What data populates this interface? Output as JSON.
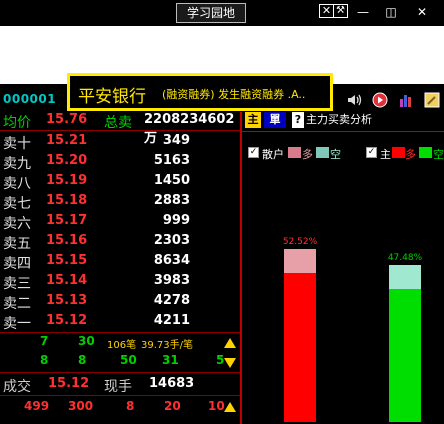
{
  "window": {
    "title_button": "学习园地",
    "sys_buttons": [
      "☒",
      "—",
      "▭",
      "✕"
    ]
  },
  "stock": {
    "code": "000001",
    "name": "平安银行",
    "tag": "(融资融券)",
    "desc": "发生融资融券 .A.."
  },
  "row0": {
    "left_label": "均价",
    "left_value": "15.76",
    "mid_label": "总卖",
    "mid_value": "2208234602万"
  },
  "asks": [
    {
      "label": "卖十",
      "price": "15.21",
      "vol": "349"
    },
    {
      "label": "卖九",
      "price": "15.20",
      "vol": "5163"
    },
    {
      "label": "卖八",
      "price": "15.19",
      "vol": "1450"
    },
    {
      "label": "卖七",
      "price": "15.18",
      "vol": "2883"
    },
    {
      "label": "卖六",
      "price": "15.17",
      "vol": "999"
    },
    {
      "label": "卖五",
      "price": "15.16",
      "vol": "2303"
    },
    {
      "label": "卖四",
      "price": "15.15",
      "vol": "8634"
    },
    {
      "label": "卖三",
      "price": "15.14",
      "vol": "3983"
    },
    {
      "label": "卖二",
      "price": "15.13",
      "vol": "4278"
    },
    {
      "label": "卖一",
      "price": "15.12",
      "vol": "4211"
    }
  ],
  "queue": {
    "row1": [
      "7",
      "30",
      "106笔",
      "39.73手/笔"
    ],
    "row2": [
      "8",
      "8",
      "50",
      "31",
      "5"
    ],
    "deal_label": "成交",
    "deal_price": "15.12",
    "hand_label": "现手",
    "hand_value": "14683",
    "row3": [
      "499",
      "300",
      "8",
      "20",
      "10"
    ]
  },
  "right": {
    "tab_main": "主",
    "tab_single": "單",
    "tab_help": "?",
    "tab_analysis": "主力买卖分析",
    "legend": {
      "retail": "散户",
      "more": "多",
      "empty": "空",
      "main": "主",
      "more2": "多",
      "empty2": "空"
    },
    "bars": [
      {
        "label": "52.52%",
        "value": 52.52,
        "top_color": "#e8a0a8",
        "color": "#ff0000"
      },
      {
        "label": "47.48%",
        "value": 47.48,
        "top_color": "#a0e8d0",
        "color": "#00dd00"
      }
    ]
  },
  "colors": {
    "up": "#ff3030",
    "down": "#00d000",
    "accent": "#ffea00",
    "cyan": "#00c8c8"
  }
}
